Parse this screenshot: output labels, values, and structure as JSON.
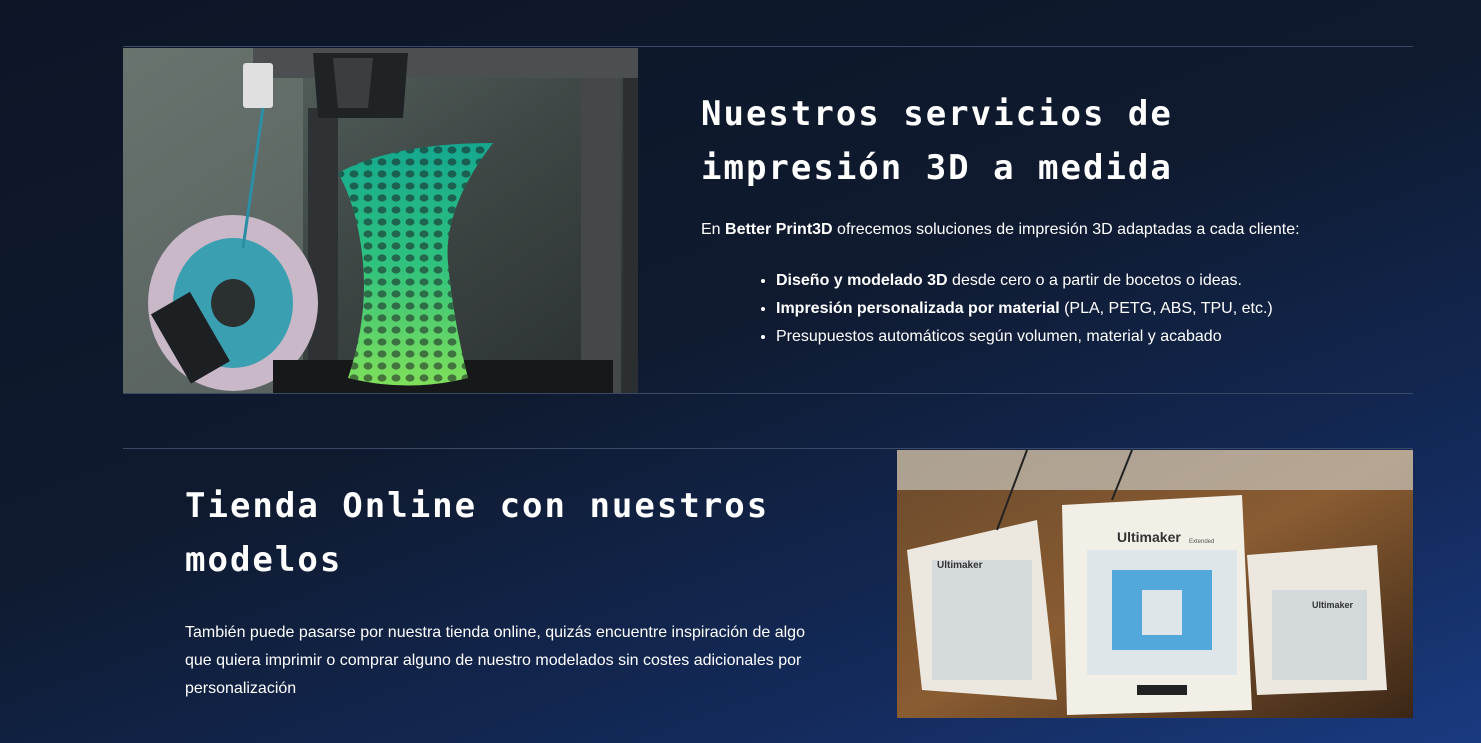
{
  "services": {
    "title_line1": "Nuestros servicios de",
    "title_line2": "impresión 3D a medida",
    "intro_prefix": "En ",
    "intro_brand": "Better Print3D",
    "intro_suffix": " ofrecemos soluciones de impresión 3D adaptadas a cada cliente:",
    "items": [
      {
        "bold": "Diseño y modelado 3D",
        "rest": " desde cero o a partir de bocetos o ideas."
      },
      {
        "bold": "Impresión personalizada por material",
        "rest": " (PLA, PETG, ABS, TPU, etc.)"
      },
      {
        "bold": "",
        "rest": "Presupuestos automáticos según volumen, material y acabado"
      }
    ]
  },
  "shop": {
    "title_line1": "Tienda Online con nuestros",
    "title_line2": "modelos",
    "body": "También puede pasarse por nuestra tienda online, quizás encuentre inspiración de algo que quiera imprimir o comprar alguno de nuestro modelados sin costes adicionales por personalización"
  },
  "images": {
    "printer_photo": {
      "logo_label": "3D printer with green lattice vase"
    },
    "ultimaker_photo": {
      "brand_main": "Ultimaker",
      "brand_left": "Ultimaker",
      "brand_right": "Ultimaker",
      "brand_sub": "Extended"
    }
  },
  "colors": {
    "background_top": "#0d1627",
    "background_bottom": "#1a3a80",
    "divider": "#3a4a66",
    "vase_green": "#2fd07a",
    "vase_teal": "#18a59a"
  }
}
